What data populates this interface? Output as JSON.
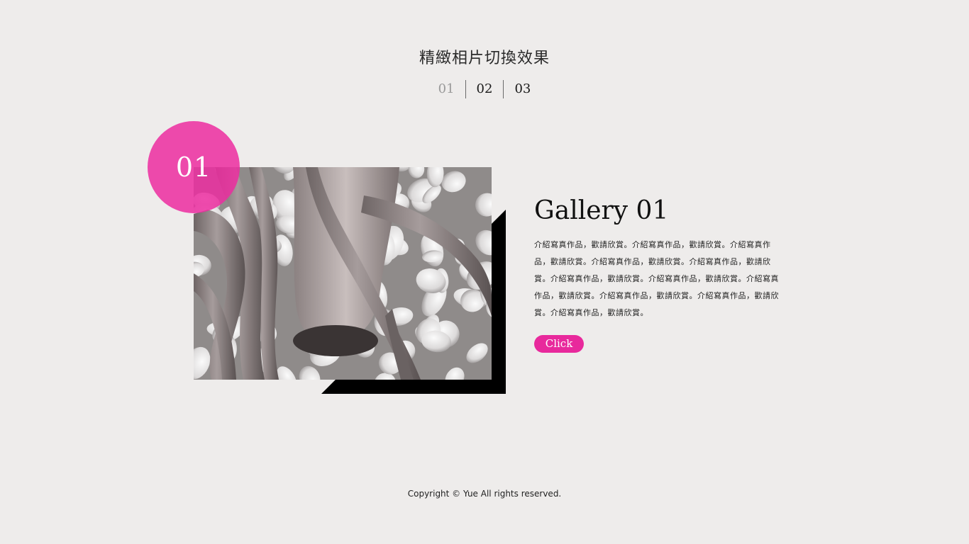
{
  "header": {
    "title": "精緻相片切換效果"
  },
  "tabs": [
    {
      "label": "01",
      "active": true
    },
    {
      "label": "02",
      "active": false
    },
    {
      "label": "03",
      "active": false
    }
  ],
  "slide": {
    "number": "01",
    "title": "Gallery 01",
    "description": "介紹寫真作品，歡請欣賞。介紹寫真作品，歡請欣賞。介紹寫真作品，歡請欣賞。介紹寫真作品，歡請欣賞。介紹寫真作品，歡請欣賞。介紹寫真作品，歡請欣賞。介紹寫真作品，歡請欣賞。介紹寫真作品，歡請欣賞。介紹寫真作品，歡請欣賞。介紹寫真作品，歡請欣賞。介紹寫真作品，歡請欣賞。",
    "button_label": "Click",
    "image_subject": "grayscale photo of tree roots over white pebbles"
  },
  "footer": {
    "copyright": "Copyright © Yue All rights reserved."
  },
  "colors": {
    "background": "#eeeceb",
    "accent": "#e8299c",
    "shadow": "#000000"
  }
}
